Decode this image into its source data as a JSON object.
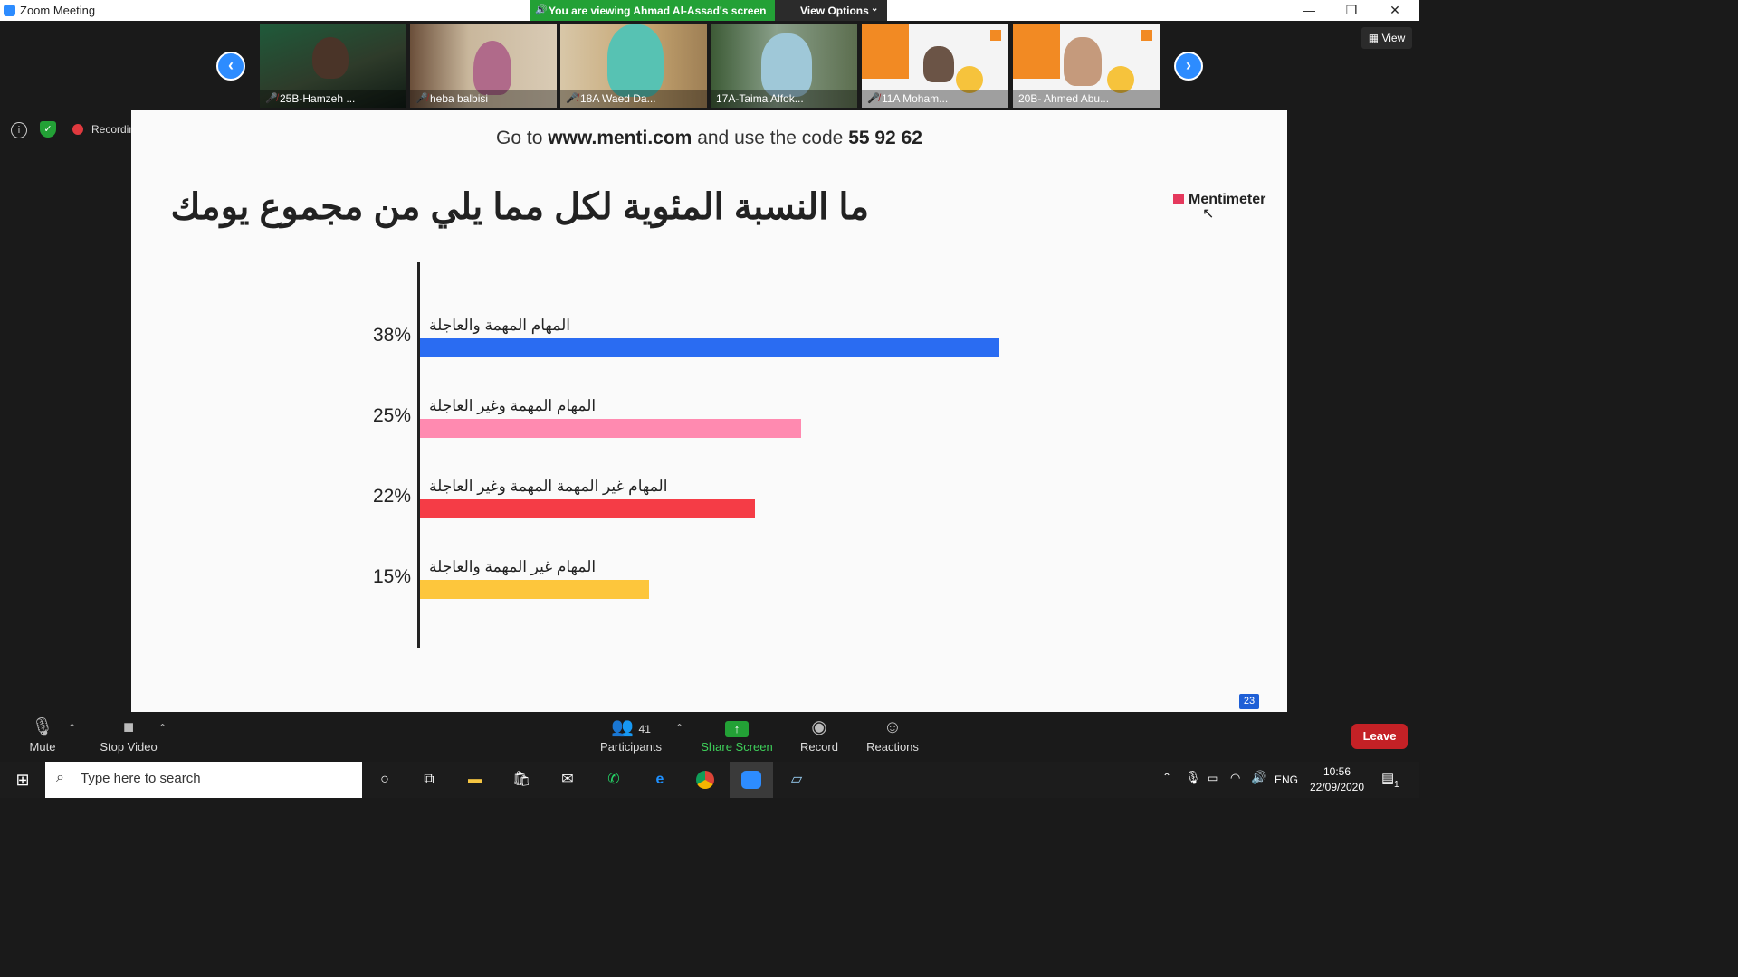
{
  "window": {
    "title": "Zoom Meeting",
    "viewing_banner": "You are viewing Ahmad Al-Assad's screen",
    "view_options": "View Options",
    "controls": [
      "—",
      "❐",
      "✕"
    ]
  },
  "gallery": {
    "view_label": "View",
    "participants": [
      {
        "name": "25B-Hamzeh ...",
        "muted": true
      },
      {
        "name": "heba balbisi",
        "muted": true
      },
      {
        "name": "18A Waed Da...",
        "muted": true
      },
      {
        "name": "17A-Taima Alfok...",
        "muted": false
      },
      {
        "name": "11A Moham...",
        "muted": true
      },
      {
        "name": "20B- Ahmed Abu...",
        "muted": false
      }
    ]
  },
  "status": {
    "recording_label": "Recordin"
  },
  "slide": {
    "instruction_prefix": "Go to",
    "instruction_site": "www.menti.com",
    "instruction_middle": "and use the code",
    "instruction_code": "55 92 62",
    "question": "ما النسبة المئوية لكل مما يلي من مجموع يومك",
    "logo": "Mentimeter",
    "counter": "23"
  },
  "chart_data": {
    "type": "bar",
    "orientation": "horizontal",
    "categories": [
      "المهام المهمة والعاجلة",
      "المهام المهمة وغير العاجلة",
      "المهام غير المهمة المهمة وغير العاجلة",
      "المهام غير المهمة والعاجلة"
    ],
    "values": [
      38,
      25,
      22,
      15
    ],
    "value_labels": [
      "38%",
      "25%",
      "22%",
      "15%"
    ],
    "colors": [
      "#2a6cf2",
      "#ff8ab0",
      "#f53c46",
      "#fdc63c"
    ],
    "xlim": [
      0,
      60
    ]
  },
  "toolbar": {
    "mute": "Mute",
    "stop_video": "Stop Video",
    "participants": "Participants",
    "participants_count": "41",
    "share_screen": "Share Screen",
    "record": "Record",
    "reactions": "Reactions",
    "leave": "Leave"
  },
  "taskbar": {
    "search_placeholder": "Type here to search",
    "language": "ENG",
    "time": "10:56",
    "date": "22/09/2020",
    "notification_count": "1"
  }
}
